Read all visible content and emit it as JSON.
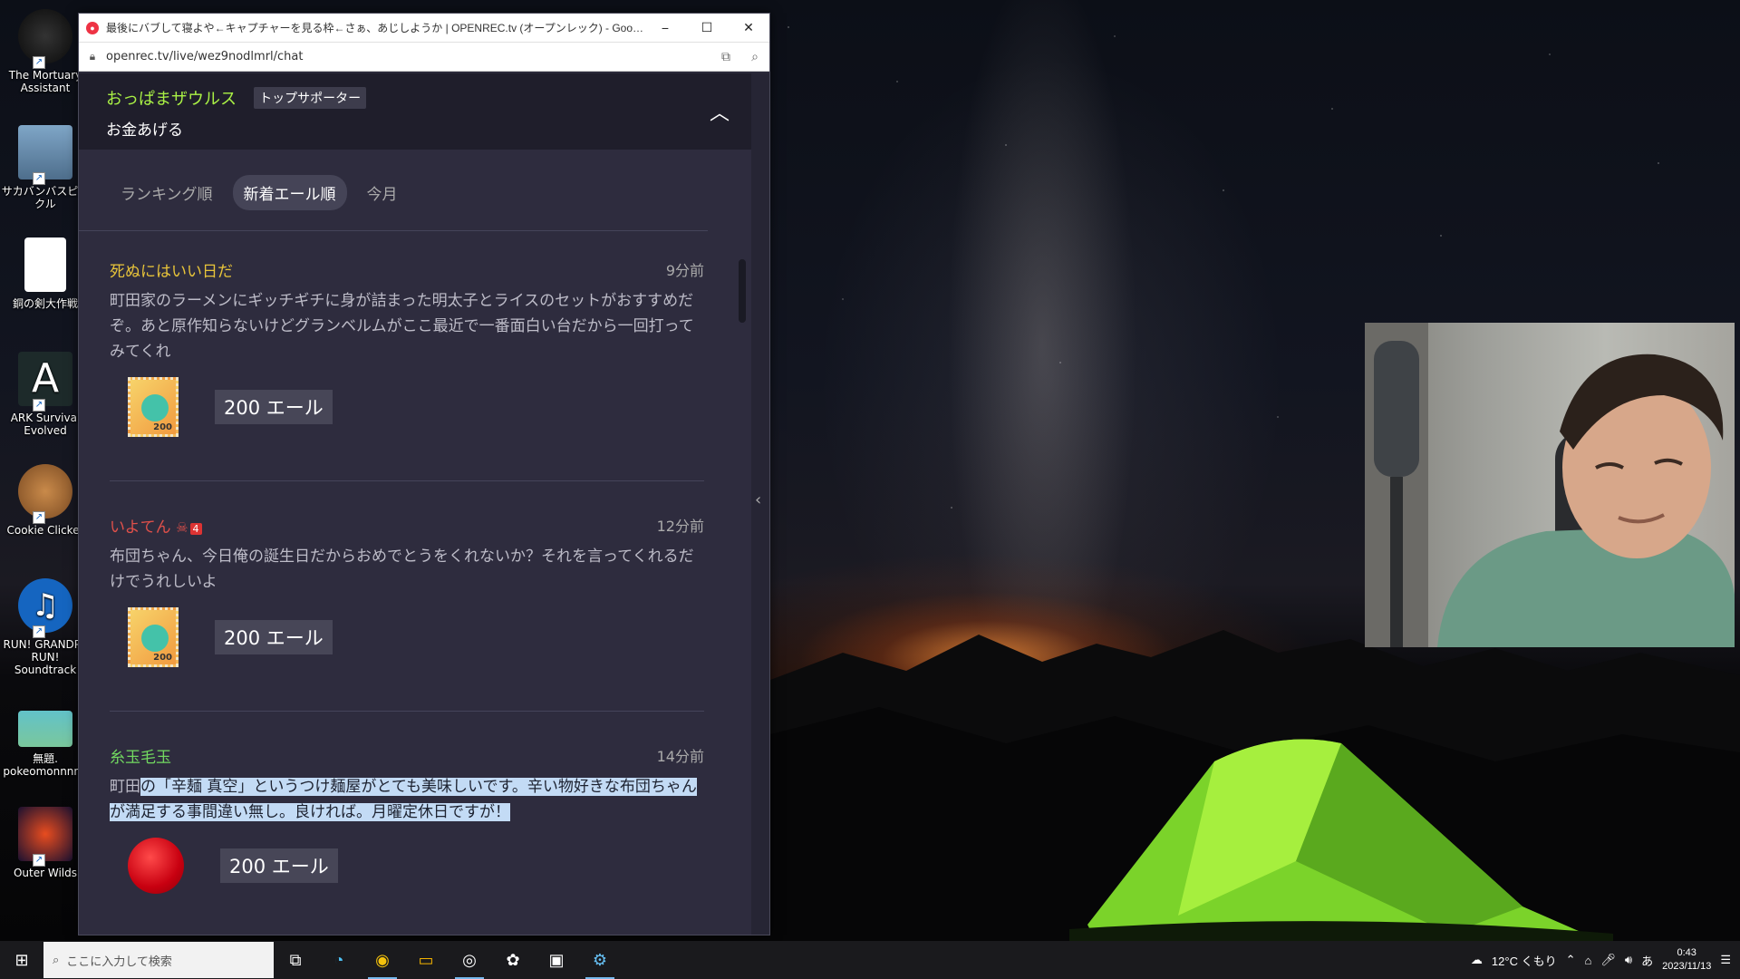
{
  "browser": {
    "title": "最後にバブして寝よや←キャプチャーを見る枠←さぁ、あじしようか | OPENREC.tv (オープンレック) - Google Chrome",
    "url": "openrec.tv/live/wez9nodlmrl/chat",
    "minimize_glyph": "−",
    "maximize_glyph": "☐",
    "close_glyph": "✕"
  },
  "top_supporter": {
    "name": "おっぱまザウルス",
    "badge": "トップサポーター",
    "message": "お金あげる"
  },
  "sort_tabs": [
    {
      "label": "ランキング順",
      "active": false
    },
    {
      "label": "新着エール順",
      "active": true
    },
    {
      "label": "今月",
      "active": false
    }
  ],
  "ale_items": [
    {
      "user": "死ぬにはいい日だ",
      "user_color": "#e8c43a",
      "time": "9分前",
      "message": "町田家のラーメンにギッチギチに身が詰まった明太子とライスのセットがおすすめだぞ。あと原作知らないけどグランベルムがここ最近で一番面白い台だから一回打ってみてくれ",
      "amount": "200 エール",
      "gift_icon": "stamp-icon"
    },
    {
      "user": "いよてん",
      "user_color": "#e0504a",
      "user_badge": "4",
      "time": "12分前",
      "message": "布団ちゃん、今日俺の誕生日だからおめでとうをくれないか？それを言ってくれるだけでうれしいよ",
      "amount": "200 エール",
      "gift_icon": "stamp-icon"
    },
    {
      "user": "糸玉毛玉",
      "user_color": "#72d860",
      "time": "14分前",
      "message_plain": "町田",
      "message_highlighted": "の「辛麺 真空」というつけ麺屋がとても美味しいです。辛い物好きな布団ちゃんが満足する事間違い無し。良ければ。月曜定休日ですが！",
      "amount": "200 エール",
      "gift_icon": "red-ball-icon"
    }
  ],
  "desktop_icons": [
    {
      "label": "The Mortuary Assistant"
    },
    {
      "label": "サカバンバスピスクル"
    },
    {
      "label": "銅の剣大作戦"
    },
    {
      "label": "ARK Survival Evolved"
    },
    {
      "label": "Cookie Clicker"
    },
    {
      "label": "RUN! GRANDPA RUN! Soundtrack"
    },
    {
      "label": "無題. pokeomonnnnn"
    },
    {
      "label": "Outer Wilds"
    }
  ],
  "taskbar": {
    "search_placeholder": "ここに入力して検索",
    "weather": "12°C くもり",
    "ime": "あ",
    "time": "0:43",
    "date": "2023/11/13"
  },
  "colors": {
    "accent_green": "#a9f045",
    "panel_bg": "#2e2c3e",
    "highlight": "#c3dbf5"
  }
}
